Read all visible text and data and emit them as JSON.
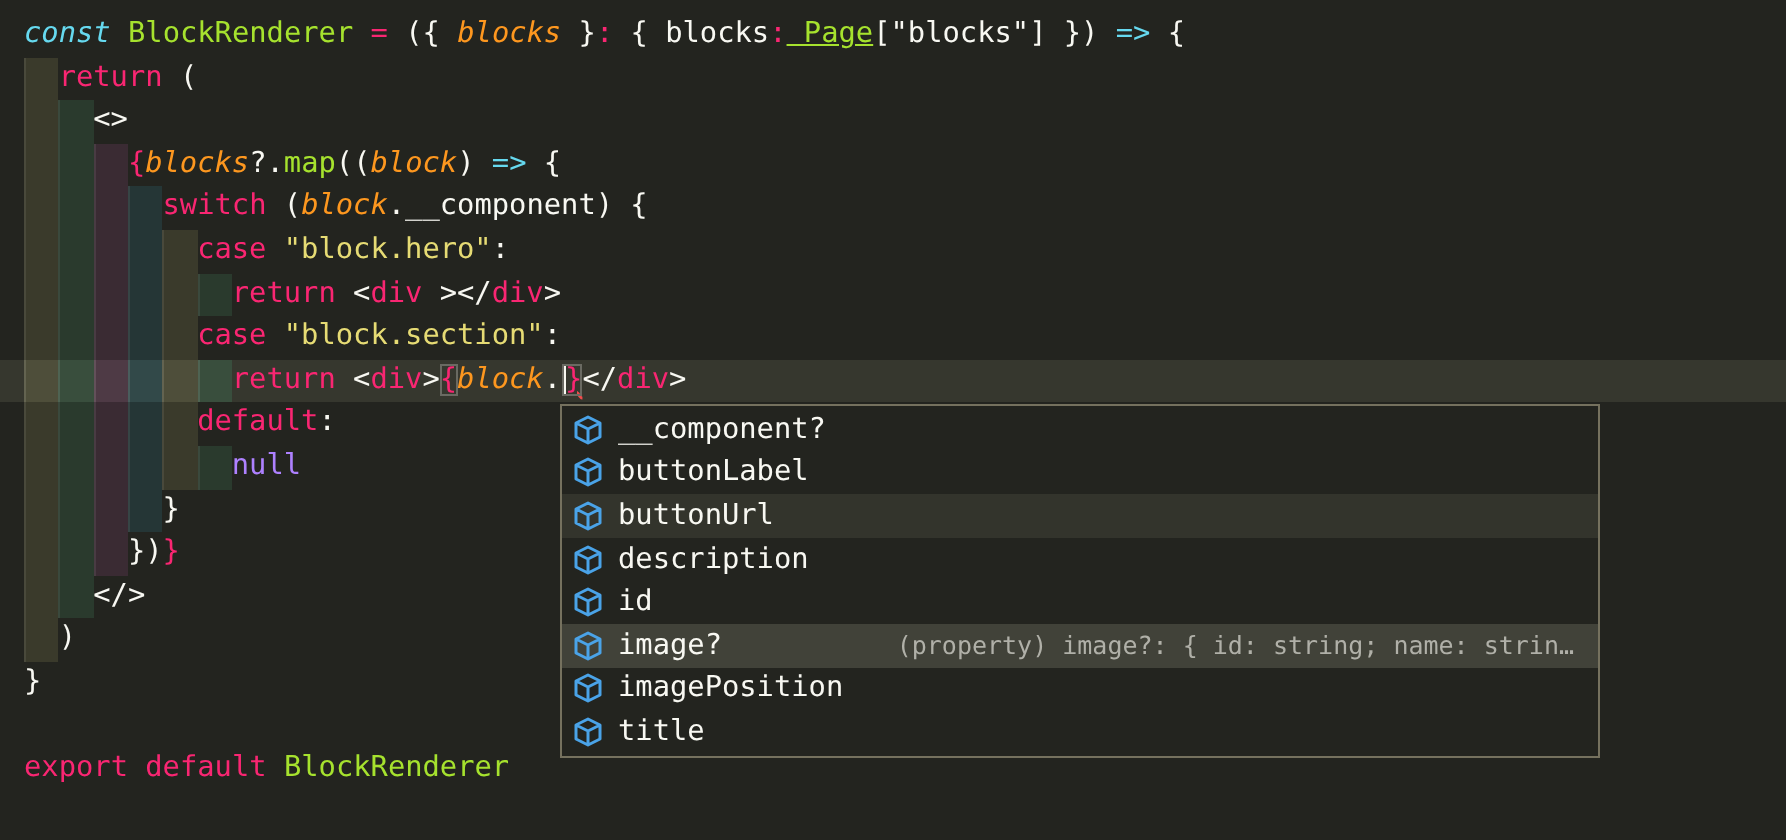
{
  "editor": {
    "lines": [
      {
        "tokens": [
          {
            "kind": "storage",
            "text": "const"
          },
          {
            "kind": "function",
            "text": " BlockRenderer"
          },
          {
            "kind": "operator",
            "text": " ="
          },
          {
            "kind": "plain",
            "text": " ({"
          },
          {
            "kind": "param",
            "text": " blocks"
          },
          {
            "kind": "plain",
            "text": " }"
          },
          {
            "kind": "operator",
            "text": ":"
          },
          {
            "kind": "plain",
            "text": " { blocks"
          },
          {
            "kind": "operator",
            "text": ":"
          },
          {
            "kind": "type",
            "text": " Page"
          },
          {
            "kind": "plain",
            "text": "[\"blocks\"] })"
          },
          {
            "kind": "arrow",
            "text": " =>"
          },
          {
            "kind": "plain",
            "text": " {"
          }
        ],
        "current": false
      },
      {
        "tokens": [
          {
            "kind": "keyword",
            "text": "  return"
          },
          {
            "kind": "plain",
            "text": " ("
          }
        ],
        "current": false
      },
      {
        "tokens": [
          {
            "kind": "plain",
            "text": "    <>"
          }
        ],
        "current": false
      },
      {
        "tokens": [
          {
            "kind": "keyword",
            "text": "      {"
          },
          {
            "kind": "param",
            "text": "blocks"
          },
          {
            "kind": "plain",
            "text": "?."
          },
          {
            "kind": "function",
            "text": "map"
          },
          {
            "kind": "plain",
            "text": "(("
          },
          {
            "kind": "param",
            "text": "block"
          },
          {
            "kind": "plain",
            "text": ")"
          },
          {
            "kind": "arrow",
            "text": " =>"
          },
          {
            "kind": "plain",
            "text": " {"
          }
        ],
        "current": false
      },
      {
        "tokens": [
          {
            "kind": "keyword",
            "text": "        switch"
          },
          {
            "kind": "plain",
            "text": " ("
          },
          {
            "kind": "param",
            "text": "block"
          },
          {
            "kind": "plain",
            "text": ".__component) {"
          }
        ],
        "current": false
      },
      {
        "tokens": [
          {
            "kind": "keyword",
            "text": "          case"
          },
          {
            "kind": "string",
            "text": " \"block.hero\""
          },
          {
            "kind": "plain",
            "text": ":"
          }
        ],
        "current": false
      },
      {
        "tokens": [
          {
            "kind": "keyword",
            "text": "            return"
          },
          {
            "kind": "plain",
            "text": " <"
          },
          {
            "kind": "keyword",
            "text": "div"
          },
          {
            "kind": "plain",
            "text": " ></"
          },
          {
            "kind": "keyword",
            "text": "div"
          },
          {
            "kind": "plain",
            "text": ">"
          }
        ],
        "current": false
      },
      {
        "tokens": [
          {
            "kind": "keyword",
            "text": "          case"
          },
          {
            "kind": "string",
            "text": " \"block.section\""
          },
          {
            "kind": "plain",
            "text": ":"
          }
        ],
        "current": false
      },
      {
        "tokens": [
          {
            "kind": "keyword",
            "text": "            return"
          },
          {
            "kind": "plain",
            "text": " <"
          },
          {
            "kind": "keyword",
            "text": "div"
          },
          {
            "kind": "plain",
            "text": ">"
          },
          {
            "kind": "match",
            "text": "{"
          },
          {
            "kind": "param",
            "text": "block"
          },
          {
            "kind": "plain",
            "text": "."
          },
          {
            "kind": "match",
            "text": "}",
            "cursor_before": true,
            "error": true
          },
          {
            "kind": "plain",
            "text": "</"
          },
          {
            "kind": "keyword",
            "text": "div"
          },
          {
            "kind": "plain",
            "text": ">"
          }
        ],
        "current": true
      },
      {
        "tokens": [
          {
            "kind": "keyword",
            "text": "          default"
          },
          {
            "kind": "plain",
            "text": ":"
          }
        ],
        "current": false
      },
      {
        "tokens": [
          {
            "kind": "constant",
            "text": "            null"
          }
        ],
        "current": false
      },
      {
        "tokens": [
          {
            "kind": "plain",
            "text": "        }"
          }
        ],
        "current": false
      },
      {
        "tokens": [
          {
            "kind": "plain",
            "text": "      })"
          },
          {
            "kind": "keyword",
            "text": "}"
          }
        ],
        "current": false
      },
      {
        "tokens": [
          {
            "kind": "plain",
            "text": "    </>"
          }
        ],
        "current": false
      },
      {
        "tokens": [
          {
            "kind": "plain",
            "text": "  )"
          }
        ],
        "current": false
      },
      {
        "tokens": [
          {
            "kind": "plain",
            "text": "}"
          }
        ],
        "current": false
      },
      {
        "current": false
      },
      {
        "tokens": [
          {
            "kind": "keyword",
            "text": "export"
          },
          {
            "kind": "keyword",
            "text": " default"
          },
          {
            "kind": "function",
            "text": " BlockRenderer"
          }
        ],
        "current": false
      }
    ]
  },
  "suggestions": [
    {
      "label": "__component?",
      "selected": false,
      "hovered": false
    },
    {
      "label": "buttonLabel",
      "selected": false,
      "hovered": false
    },
    {
      "label": "buttonUrl",
      "selected": false,
      "hovered": true
    },
    {
      "label": "description",
      "selected": false,
      "hovered": false
    },
    {
      "label": "id",
      "selected": false,
      "hovered": false
    },
    {
      "label": "image?",
      "selected": true,
      "hovered": false,
      "detail": "(property) image?: { id: string; name: strin…"
    },
    {
      "label": "imagePosition",
      "selected": false,
      "hovered": false
    },
    {
      "label": "title",
      "selected": false,
      "hovered": false
    }
  ]
}
